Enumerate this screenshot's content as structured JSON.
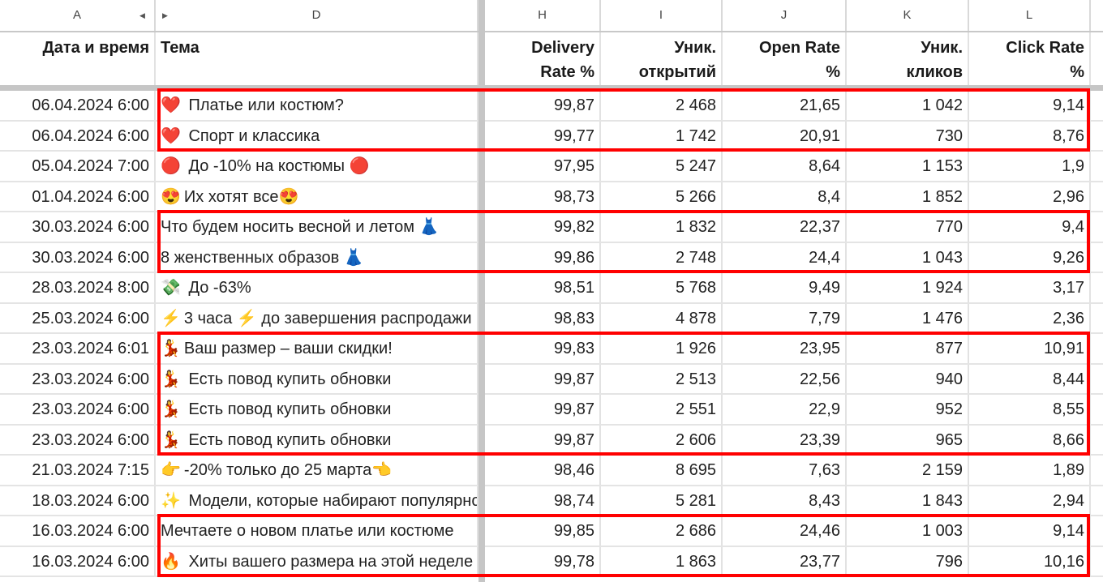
{
  "column_letters": [
    "A",
    "D",
    "H",
    "I",
    "J",
    "K",
    "L"
  ],
  "headers": {
    "date": "Дата и время",
    "subject": "Тема",
    "delivery": [
      "Delivery",
      "Rate %"
    ],
    "opens": [
      "Уник.",
      "открытий"
    ],
    "open_rate": [
      "Open Rate",
      "%"
    ],
    "clicks": [
      "Уник.",
      "кликов"
    ],
    "click_rate": [
      "Click Rate",
      "%"
    ]
  },
  "rows": [
    {
      "date": "06.04.2024 6:00",
      "emoji": "❤️",
      "subject": " Платье или костюм?",
      "delivery": "99,87",
      "opens": "2 468",
      "open_rate": "21,65",
      "clicks": "1 042",
      "click_rate": "9,14"
    },
    {
      "date": "06.04.2024 6:00",
      "emoji": "❤️",
      "subject": " Спорт и классика",
      "delivery": "99,77",
      "opens": "1 742",
      "open_rate": "20,91",
      "clicks": "730",
      "click_rate": "8,76"
    },
    {
      "date": "05.04.2024 7:00",
      "emoji": "🔴",
      "subject": " До -10% на костюмы 🔴",
      "delivery": "97,95",
      "opens": "5 247",
      "open_rate": "8,64",
      "clicks": "1 153",
      "click_rate": "1,9"
    },
    {
      "date": "01.04.2024 6:00",
      "emoji": "😍",
      "subject": "Их хотят все😍",
      "delivery": "98,73",
      "opens": "5 266",
      "open_rate": "8,4",
      "clicks": "1 852",
      "click_rate": "2,96"
    },
    {
      "date": "30.03.2024 6:00",
      "emoji": "",
      "subject": "Что будем носить весной и летом 👗",
      "delivery": "99,82",
      "opens": "1 832",
      "open_rate": "22,37",
      "clicks": "770",
      "click_rate": "9,4"
    },
    {
      "date": "30.03.2024 6:00",
      "emoji": "",
      "subject": "8 женственных образов 👗",
      "delivery": "99,86",
      "opens": "2 748",
      "open_rate": "24,4",
      "clicks": "1 043",
      "click_rate": "9,26"
    },
    {
      "date": "28.03.2024 8:00",
      "emoji": "💸",
      "subject": " До -63%",
      "delivery": "98,51",
      "opens": "5 768",
      "open_rate": "9,49",
      "clicks": "1 924",
      "click_rate": "3,17"
    },
    {
      "date": "25.03.2024 6:00",
      "emoji": "⚡",
      "subject": "3 часа ⚡ до завершения распродажи",
      "delivery": "98,83",
      "opens": "4 878",
      "open_rate": "7,79",
      "clicks": "1 476",
      "click_rate": "2,36"
    },
    {
      "date": "23.03.2024 6:01",
      "emoji": "💃",
      "subject": "Ваш размер – ваши скидки!",
      "delivery": "99,83",
      "opens": "1 926",
      "open_rate": "23,95",
      "clicks": "877",
      "click_rate": "10,91"
    },
    {
      "date": "23.03.2024 6:00",
      "emoji": "💃",
      "subject": " Есть повод купить обновки",
      "delivery": "99,87",
      "opens": "2 513",
      "open_rate": "22,56",
      "clicks": "940",
      "click_rate": "8,44"
    },
    {
      "date": "23.03.2024 6:00",
      "emoji": "💃",
      "subject": " Есть повод купить обновки",
      "delivery": "99,87",
      "opens": "2 551",
      "open_rate": "22,9",
      "clicks": "952",
      "click_rate": "8,55"
    },
    {
      "date": "23.03.2024 6:00",
      "emoji": "💃",
      "subject": " Есть повод купить обновки",
      "delivery": "99,87",
      "opens": "2 606",
      "open_rate": "23,39",
      "clicks": "965",
      "click_rate": "8,66"
    },
    {
      "date": "21.03.2024 7:15",
      "emoji": "👉",
      "subject": "-20% только до 25 марта👈",
      "delivery": "98,46",
      "opens": "8 695",
      "open_rate": "7,63",
      "clicks": "2 159",
      "click_rate": "1,89"
    },
    {
      "date": "18.03.2024 6:00",
      "emoji": "✨",
      "subject": " Модели, которые набирают популярность",
      "delivery": "98,74",
      "opens": "5 281",
      "open_rate": "8,43",
      "clicks": "1 843",
      "click_rate": "2,94"
    },
    {
      "date": "16.03.2024 6:00",
      "emoji": "",
      "subject": "Мечтаете о новом платье или костюме",
      "delivery": "99,85",
      "opens": "2 686",
      "open_rate": "24,46",
      "clicks": "1 003",
      "click_rate": "9,14"
    },
    {
      "date": "16.03.2024 6:00",
      "emoji": "🔥",
      "subject": " Хиты вашего размера на этой неделе",
      "delivery": "99,78",
      "opens": "1 863",
      "open_rate": "23,77",
      "clicks": "796",
      "click_rate": "10,16"
    }
  ],
  "highlight_groups": [
    [
      0,
      1
    ],
    [
      4,
      5
    ],
    [
      8,
      11
    ],
    [
      14,
      15
    ]
  ],
  "highlight_color": "#ff0000"
}
